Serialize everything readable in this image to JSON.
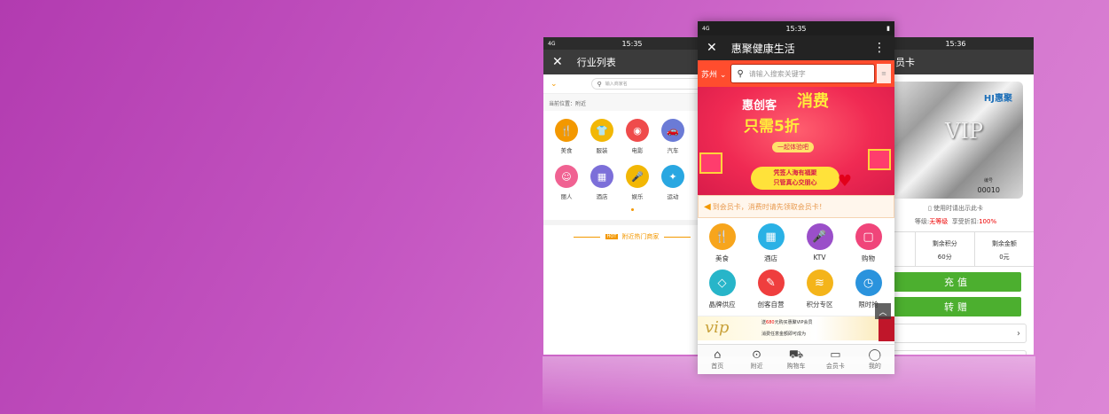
{
  "colors": {
    "accent_orange": "#f39800",
    "brand_red": "#ff4d2e",
    "green": "#4caf2f"
  },
  "left_phone": {
    "status": {
      "network": "4G",
      "time": "15:35"
    },
    "title": "行业列表",
    "search_placeholder": "输入商家名",
    "location": "当前位置：附近",
    "categories": [
      {
        "label": "美食",
        "icon": "fork-knife-icon",
        "color": "#f39800"
      },
      {
        "label": "服装",
        "icon": "shirt-icon",
        "color": "#f2b705"
      },
      {
        "label": "电影",
        "icon": "film-reel-icon",
        "color": "#ef4b4b"
      },
      {
        "label": "汽车",
        "icon": "car-icon",
        "color": "#6b7bd6"
      },
      {
        "label": "丽人",
        "icon": "lady-icon",
        "color": "#f06292"
      },
      {
        "label": "酒店",
        "icon": "building-icon",
        "color": "#7c6fd9"
      },
      {
        "label": "娱乐",
        "icon": "microphone-icon",
        "color": "#f2b705"
      },
      {
        "label": "运动",
        "icon": "sport-icon",
        "color": "#29a7e1"
      }
    ],
    "hot_tag": "HOT",
    "hot_label": "附近热门商家"
  },
  "center_phone": {
    "status": {
      "network": "4G",
      "time": "15:35"
    },
    "title": "惠聚健康生活",
    "city": "苏州",
    "search_placeholder": "请输入搜索关键字",
    "banner": {
      "line1": "惠创客",
      "line1b": "消费",
      "line2": "只需5折",
      "pill": "一起体验吧",
      "ribbon_1": "凭签人海有福聚",
      "ribbon_2": "只管真心交朋心"
    },
    "notice": "到会员卡，消费时请先领取会员卡！",
    "categories": [
      {
        "label": "美食",
        "icon": "fork-knife-icon",
        "color": "#f7a51c"
      },
      {
        "label": "酒店",
        "icon": "building-icon",
        "color": "#2ab1e5"
      },
      {
        "label": "KTV",
        "icon": "microphone-icon",
        "color": "#9a4fc9"
      },
      {
        "label": "购物",
        "icon": "shopping-bag-icon",
        "color": "#f0457a"
      },
      {
        "label": "晶牌供应",
        "icon": "diamond-icon",
        "color": "#27b5c9"
      },
      {
        "label": "创客自营",
        "icon": "chat-icon",
        "color": "#ef3e3e"
      },
      {
        "label": "积分专区",
        "icon": "coins-icon",
        "color": "#f4b41a"
      },
      {
        "label": "限时抢",
        "icon": "clock-icon",
        "color": "#2a93dd"
      }
    ],
    "vip": {
      "logo": "vip",
      "line1_a": "送",
      "line1_b": "680",
      "line1_c": "元购买惠聚VIP会员",
      "line2": "消费任意金额即可成为"
    },
    "tabs": [
      {
        "label": "首页",
        "icon": "home-icon"
      },
      {
        "label": "附近",
        "icon": "location-pin-icon"
      },
      {
        "label": "购物车",
        "icon": "cart-icon"
      },
      {
        "label": "会员卡",
        "icon": "card-icon"
      },
      {
        "label": "我的",
        "icon": "user-icon"
      }
    ]
  },
  "right_phone": {
    "status": {
      "time": "15:36"
    },
    "title": "员卡",
    "card": {
      "brand": "HJ惠聚",
      "vip_text": "VIP",
      "number_label": "编号",
      "number": "00010"
    },
    "use_hint": "使用时请出示此卡",
    "level_label": "等级:",
    "level_value": "无等级",
    "discount_label": "享受折扣:",
    "discount_value": "100%",
    "stats": [
      {
        "label": "总额",
        "value": ""
      },
      {
        "label": "剩余积分",
        "value": "60分"
      },
      {
        "label": "剩余金额",
        "value": "0元"
      }
    ],
    "recharge_label": "充值",
    "transfer_label": "转赠",
    "rows": [
      "",
      "",
      "品"
    ]
  }
}
